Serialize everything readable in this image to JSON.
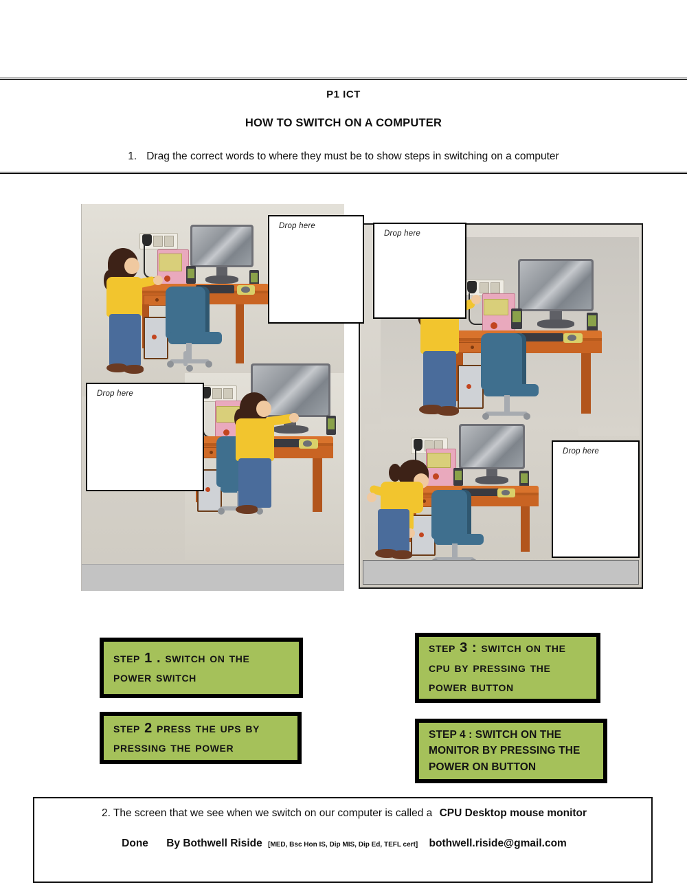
{
  "header": {
    "page_code": "P1  ICT",
    "doc_title": "HOW TO SWITCH ON A COMPUTER",
    "question_1_number": "1.",
    "question_1_text": "Drag the correct words to where they must be to show steps in switching on a computer"
  },
  "dropzones": [
    {
      "id": "dropzone-1",
      "label": "Drop  here"
    },
    {
      "id": "dropzone-2",
      "label": "Drop here"
    },
    {
      "id": "dropzone-3",
      "label": "Drop here"
    },
    {
      "id": "dropzone-4",
      "label": "Drop here"
    }
  ],
  "steps": [
    {
      "id": "step-1",
      "text": "Step 1 . Switch on the power switch"
    },
    {
      "id": "step-2",
      "text": "Step 2 Press the UPS by pressing the power"
    },
    {
      "id": "step-3",
      "text": "Step 3  : Switch on the CPU by pressing the power button"
    },
    {
      "id": "step-4",
      "text": "STEP 4 : SWITCH ON THE MONITOR BY PRESSING THE POWER ON BUTTON"
    }
  ],
  "footer": {
    "question_2_text": "2. The screen that we see when we switch on our computer is called a",
    "question_2_options": "CPU Desktop mouse monitor",
    "done_label": "Done",
    "author": "By Bothwell Riside",
    "qualifications": "[MED, Bsc Hon IS, Dip MIS, Dip Ed, TEFL cert]",
    "email": "bothwell.riside@gmail.com"
  },
  "colors": {
    "step_card_background": "#a5c15a",
    "step_card_border": "#000000",
    "panel_background": "#cfcdc9",
    "gray_band": "#c3c3c3"
  }
}
